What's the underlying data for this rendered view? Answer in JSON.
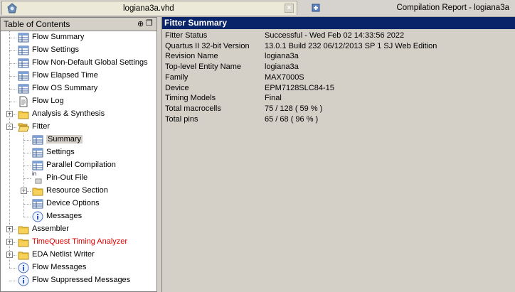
{
  "tabs": [
    {
      "title": "logiana3a.vhd",
      "close": "×"
    },
    {
      "title": "Compilation Report - logiana3a"
    }
  ],
  "toc": {
    "title": "Table of Contents",
    "pin_glyph": "⊕",
    "float_glyph": "❐",
    "items": [
      {
        "label": "Flow Summary",
        "icon": "table-icon"
      },
      {
        "label": "Flow Settings",
        "icon": "table-icon"
      },
      {
        "label": "Flow Non-Default Global Settings",
        "icon": "table-icon"
      },
      {
        "label": "Flow Elapsed Time",
        "icon": "table-icon"
      },
      {
        "label": "Flow OS Summary",
        "icon": "table-icon"
      },
      {
        "label": "Flow Log",
        "icon": "document-icon"
      },
      {
        "label": "Analysis & Synthesis",
        "icon": "folder-icon",
        "expander": "+"
      },
      {
        "label": "Fitter",
        "icon": "folder-open-icon",
        "expander": "−"
      },
      {
        "label": "Summary",
        "icon": "table-icon",
        "selected": true
      },
      {
        "label": "Settings",
        "icon": "table-icon"
      },
      {
        "label": "Parallel Compilation",
        "icon": "table-icon"
      },
      {
        "label": "Pin-Out File",
        "icon": "file-in-icon",
        "glyph": "in"
      },
      {
        "label": "Resource Section",
        "icon": "folder-icon",
        "expander": "+"
      },
      {
        "label": "Device Options",
        "icon": "table-icon"
      },
      {
        "label": "Messages",
        "icon": "info-icon"
      },
      {
        "label": "Assembler",
        "icon": "folder-icon",
        "expander": "+"
      },
      {
        "label": "TimeQuest Timing Analyzer",
        "icon": "folder-icon",
        "expander": "+",
        "color": "#e00000"
      },
      {
        "label": "EDA Netlist Writer",
        "icon": "folder-icon",
        "expander": "+"
      },
      {
        "label": "Flow Messages",
        "icon": "info-icon"
      },
      {
        "label": "Flow Suppressed Messages",
        "icon": "info-icon"
      }
    ]
  },
  "report": {
    "title": "Fitter Summary",
    "rows": [
      {
        "key": "Fitter Status",
        "value": "Successful - Wed Feb 02 14:33:56 2022"
      },
      {
        "key": "Quartus II 32-bit Version",
        "value": "13.0.1 Build 232 06/12/2013 SP 1 SJ Web Edition"
      },
      {
        "key": "Revision Name",
        "value": "logiana3a"
      },
      {
        "key": "Top-level Entity Name",
        "value": "logiana3a"
      },
      {
        "key": "Family",
        "value": "MAX7000S"
      },
      {
        "key": "Device",
        "value": "EPM7128SLC84-15"
      },
      {
        "key": "Timing Models",
        "value": "Final"
      },
      {
        "key": "Total macrocells",
        "value": "75 / 128 ( 59 % )"
      },
      {
        "key": "Total pins",
        "value": "65 / 68 ( 96 % )"
      }
    ]
  }
}
